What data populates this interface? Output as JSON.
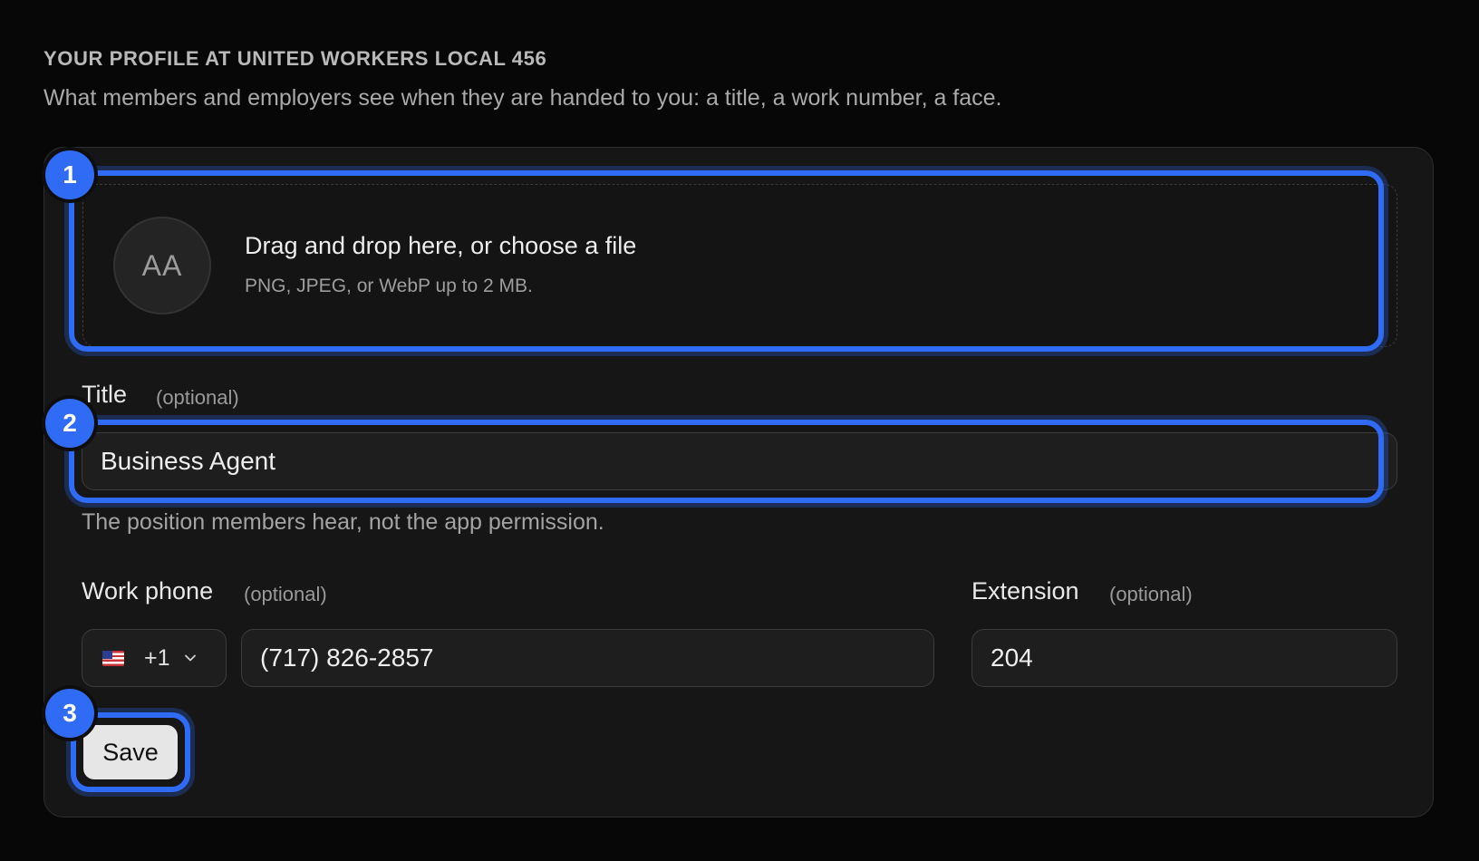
{
  "header": {
    "title": "YOUR PROFILE AT UNITED WORKERS LOCAL 456",
    "subtitle": "What members and employers see when they are handed to you: a title, a work number, a face."
  },
  "avatar_upload": {
    "initials": "AA",
    "prompt": "Drag and drop here, or choose a file",
    "hint": "PNG, JPEG, or WebP up to 2 MB."
  },
  "title_field": {
    "label": "Title",
    "optional": "(optional)",
    "value": "Business Agent",
    "helper": "The position members hear, not the app permission."
  },
  "phone_field": {
    "label": "Work phone",
    "optional": "(optional)",
    "country_flag": "us-flag-icon",
    "dial_code": "+1",
    "value": "(717) 826-2857"
  },
  "extension_field": {
    "label": "Extension",
    "optional": "(optional)",
    "value": "204"
  },
  "actions": {
    "save_label": "Save"
  },
  "annotations": {
    "badge_1": "1",
    "badge_2": "2",
    "badge_3": "3"
  },
  "colors": {
    "accent": "#2f6bf5",
    "background": "#070707",
    "card": "#161616"
  }
}
